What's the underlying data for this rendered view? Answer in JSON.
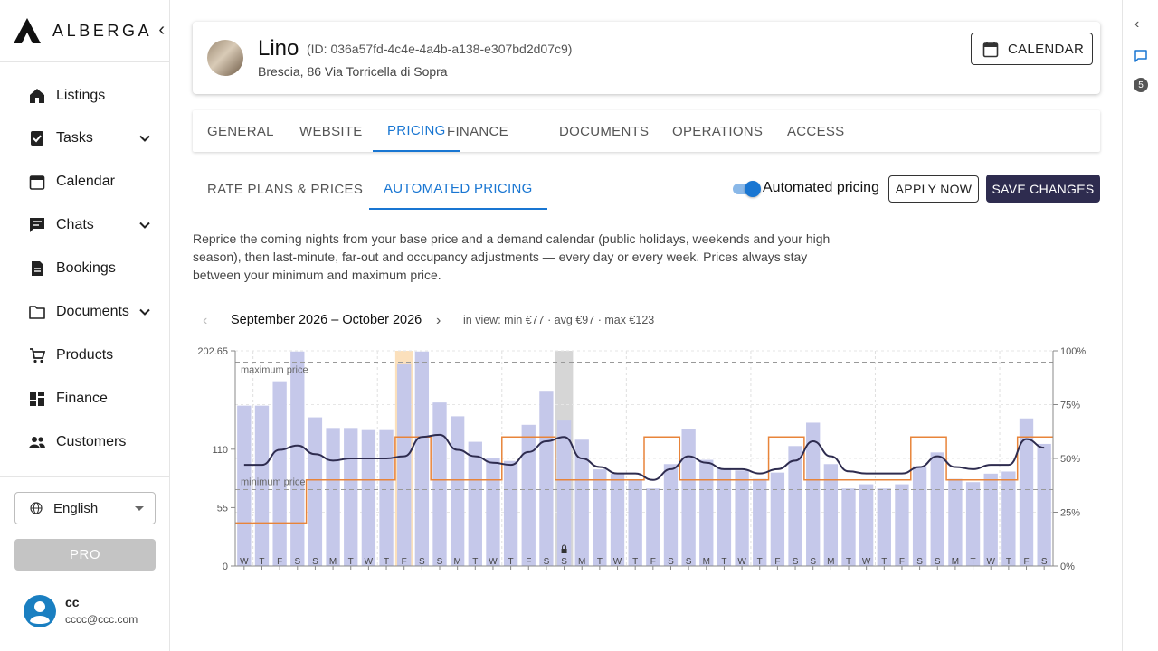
{
  "brand": {
    "name": "ALBERGA"
  },
  "nav": [
    {
      "id": "listings",
      "label": "Listings",
      "icon": "listings-icon",
      "expandable": false
    },
    {
      "id": "tasks",
      "label": "Tasks",
      "icon": "tasks-icon",
      "expandable": true
    },
    {
      "id": "calendar",
      "label": "Calendar",
      "icon": "calendar-icon",
      "expandable": false
    },
    {
      "id": "chats",
      "label": "Chats",
      "icon": "chat-icon",
      "expandable": true
    },
    {
      "id": "bookings",
      "label": "Bookings",
      "icon": "bookings-icon",
      "expandable": false
    },
    {
      "id": "documents",
      "label": "Documents",
      "icon": "folder-icon",
      "expandable": true
    },
    {
      "id": "products",
      "label": "Products",
      "icon": "cart-icon",
      "expandable": false
    },
    {
      "id": "finance",
      "label": "Finance",
      "icon": "dashboard-icon",
      "expandable": false
    },
    {
      "id": "customers",
      "label": "Customers",
      "icon": "people-icon",
      "expandable": false
    }
  ],
  "language": {
    "selected": "English"
  },
  "pro_label": "PRO",
  "user": {
    "name": "cc",
    "email": "cccc@ccc.com"
  },
  "rail": {
    "badge": "5"
  },
  "listing": {
    "title": "Lino",
    "id_text": "(ID: 036a57fd-4c4e-4a4b-a138-e307bd2d07c9)",
    "address": "Brescia, 86 Via Torricella di Sopra",
    "calendar_button": "CALENDAR"
  },
  "tabs": [
    "GENERAL",
    "WEBSITE",
    "PRICING",
    "FINANCE",
    "DOCUMENTS",
    "OPERATIONS",
    "ACCESS"
  ],
  "active_tab": "PRICING",
  "subtabs": [
    "RATE PLANS & PRICES",
    "AUTOMATED PRICING"
  ],
  "active_subtab": "AUTOMATED PRICING",
  "automated_pricing": {
    "label": "Automated pricing",
    "enabled": true
  },
  "buttons": {
    "apply": "APPLY NOW",
    "save": "SAVE CHANGES"
  },
  "description": "Reprice the coming nights from your base price and a demand calendar (public holidays, weekends and your high season), then last-minute, far-out and occupancy adjustments — every day or every week. Prices always stay between your minimum and maximum price.",
  "period": {
    "label": "September 2026 – October 2026",
    "stats": "in view: min €77 · avg €97 · max €123"
  },
  "colors": {
    "accent": "#1976d2",
    "bar": "#c5c8ea",
    "line": "#2e2c4f",
    "step": "#e8843a",
    "highlight": "#fbe0bc",
    "locked": "#d6d6d6"
  },
  "chart_data": {
    "type": "bar",
    "title": "",
    "left_axis": {
      "ticks": [
        "0",
        "55",
        "110",
        "202.65"
      ],
      "ylim": [
        0,
        202.65
      ]
    },
    "right_axis": {
      "ticks": [
        "0%",
        "25%",
        "50%",
        "75%",
        "100%"
      ],
      "ylim": [
        0,
        100
      ]
    },
    "reference_lines": [
      {
        "label": "maximum price",
        "value": 192
      },
      {
        "label": "minimum price",
        "value": 72
      }
    ],
    "x_labels": [
      "W",
      "T",
      "F",
      "S",
      "S",
      "M",
      "T",
      "W",
      "T",
      "F",
      "S",
      "S",
      "M",
      "T",
      "W",
      "T",
      "F",
      "S",
      "S",
      "M",
      "T",
      "W",
      "T",
      "F",
      "S",
      "S",
      "M",
      "T",
      "W",
      "T",
      "F",
      "S",
      "S",
      "M",
      "T",
      "W",
      "T",
      "F",
      "S",
      "S",
      "M",
      "T",
      "W",
      "T",
      "F",
      "S"
    ],
    "series": [
      {
        "name": "",
        "kind": "bar",
        "values": [
          151,
          151,
          174,
          202,
          140,
          130,
          130,
          128,
          128,
          190,
          202,
          154,
          141,
          117,
          102,
          99,
          133,
          165,
          137,
          119,
          91,
          87,
          81,
          73,
          96,
          129,
          100,
          92,
          90,
          82,
          88,
          113,
          135,
          96,
          73,
          77,
          73,
          77,
          94,
          107,
          82,
          79,
          87,
          89,
          139,
          115
        ]
      },
      {
        "name": "",
        "kind": "line",
        "values": [
          47,
          47,
          54,
          56,
          52,
          49,
          50,
          50,
          50,
          51,
          60,
          61,
          54,
          51,
          48,
          47,
          53,
          58,
          60,
          50,
          46,
          43,
          43,
          40,
          45,
          51,
          48,
          45,
          45,
          43,
          45,
          49,
          58,
          51,
          44,
          43,
          43,
          43,
          46,
          51,
          46,
          45,
          47,
          47,
          59,
          55
        ]
      },
      {
        "name": "",
        "kind": "step",
        "values": [
          20,
          20,
          20,
          20,
          40,
          40,
          40,
          40,
          40,
          60,
          60,
          40,
          40,
          40,
          40,
          60,
          60,
          60,
          40,
          40,
          40,
          40,
          40,
          60,
          60,
          40,
          40,
          40,
          40,
          40,
          60,
          60,
          40,
          40,
          40,
          40,
          40,
          40,
          60,
          60,
          40,
          40,
          40,
          40,
          60,
          60
        ]
      }
    ],
    "highlight_index": 9,
    "locked_index": 18,
    "grid": true
  }
}
